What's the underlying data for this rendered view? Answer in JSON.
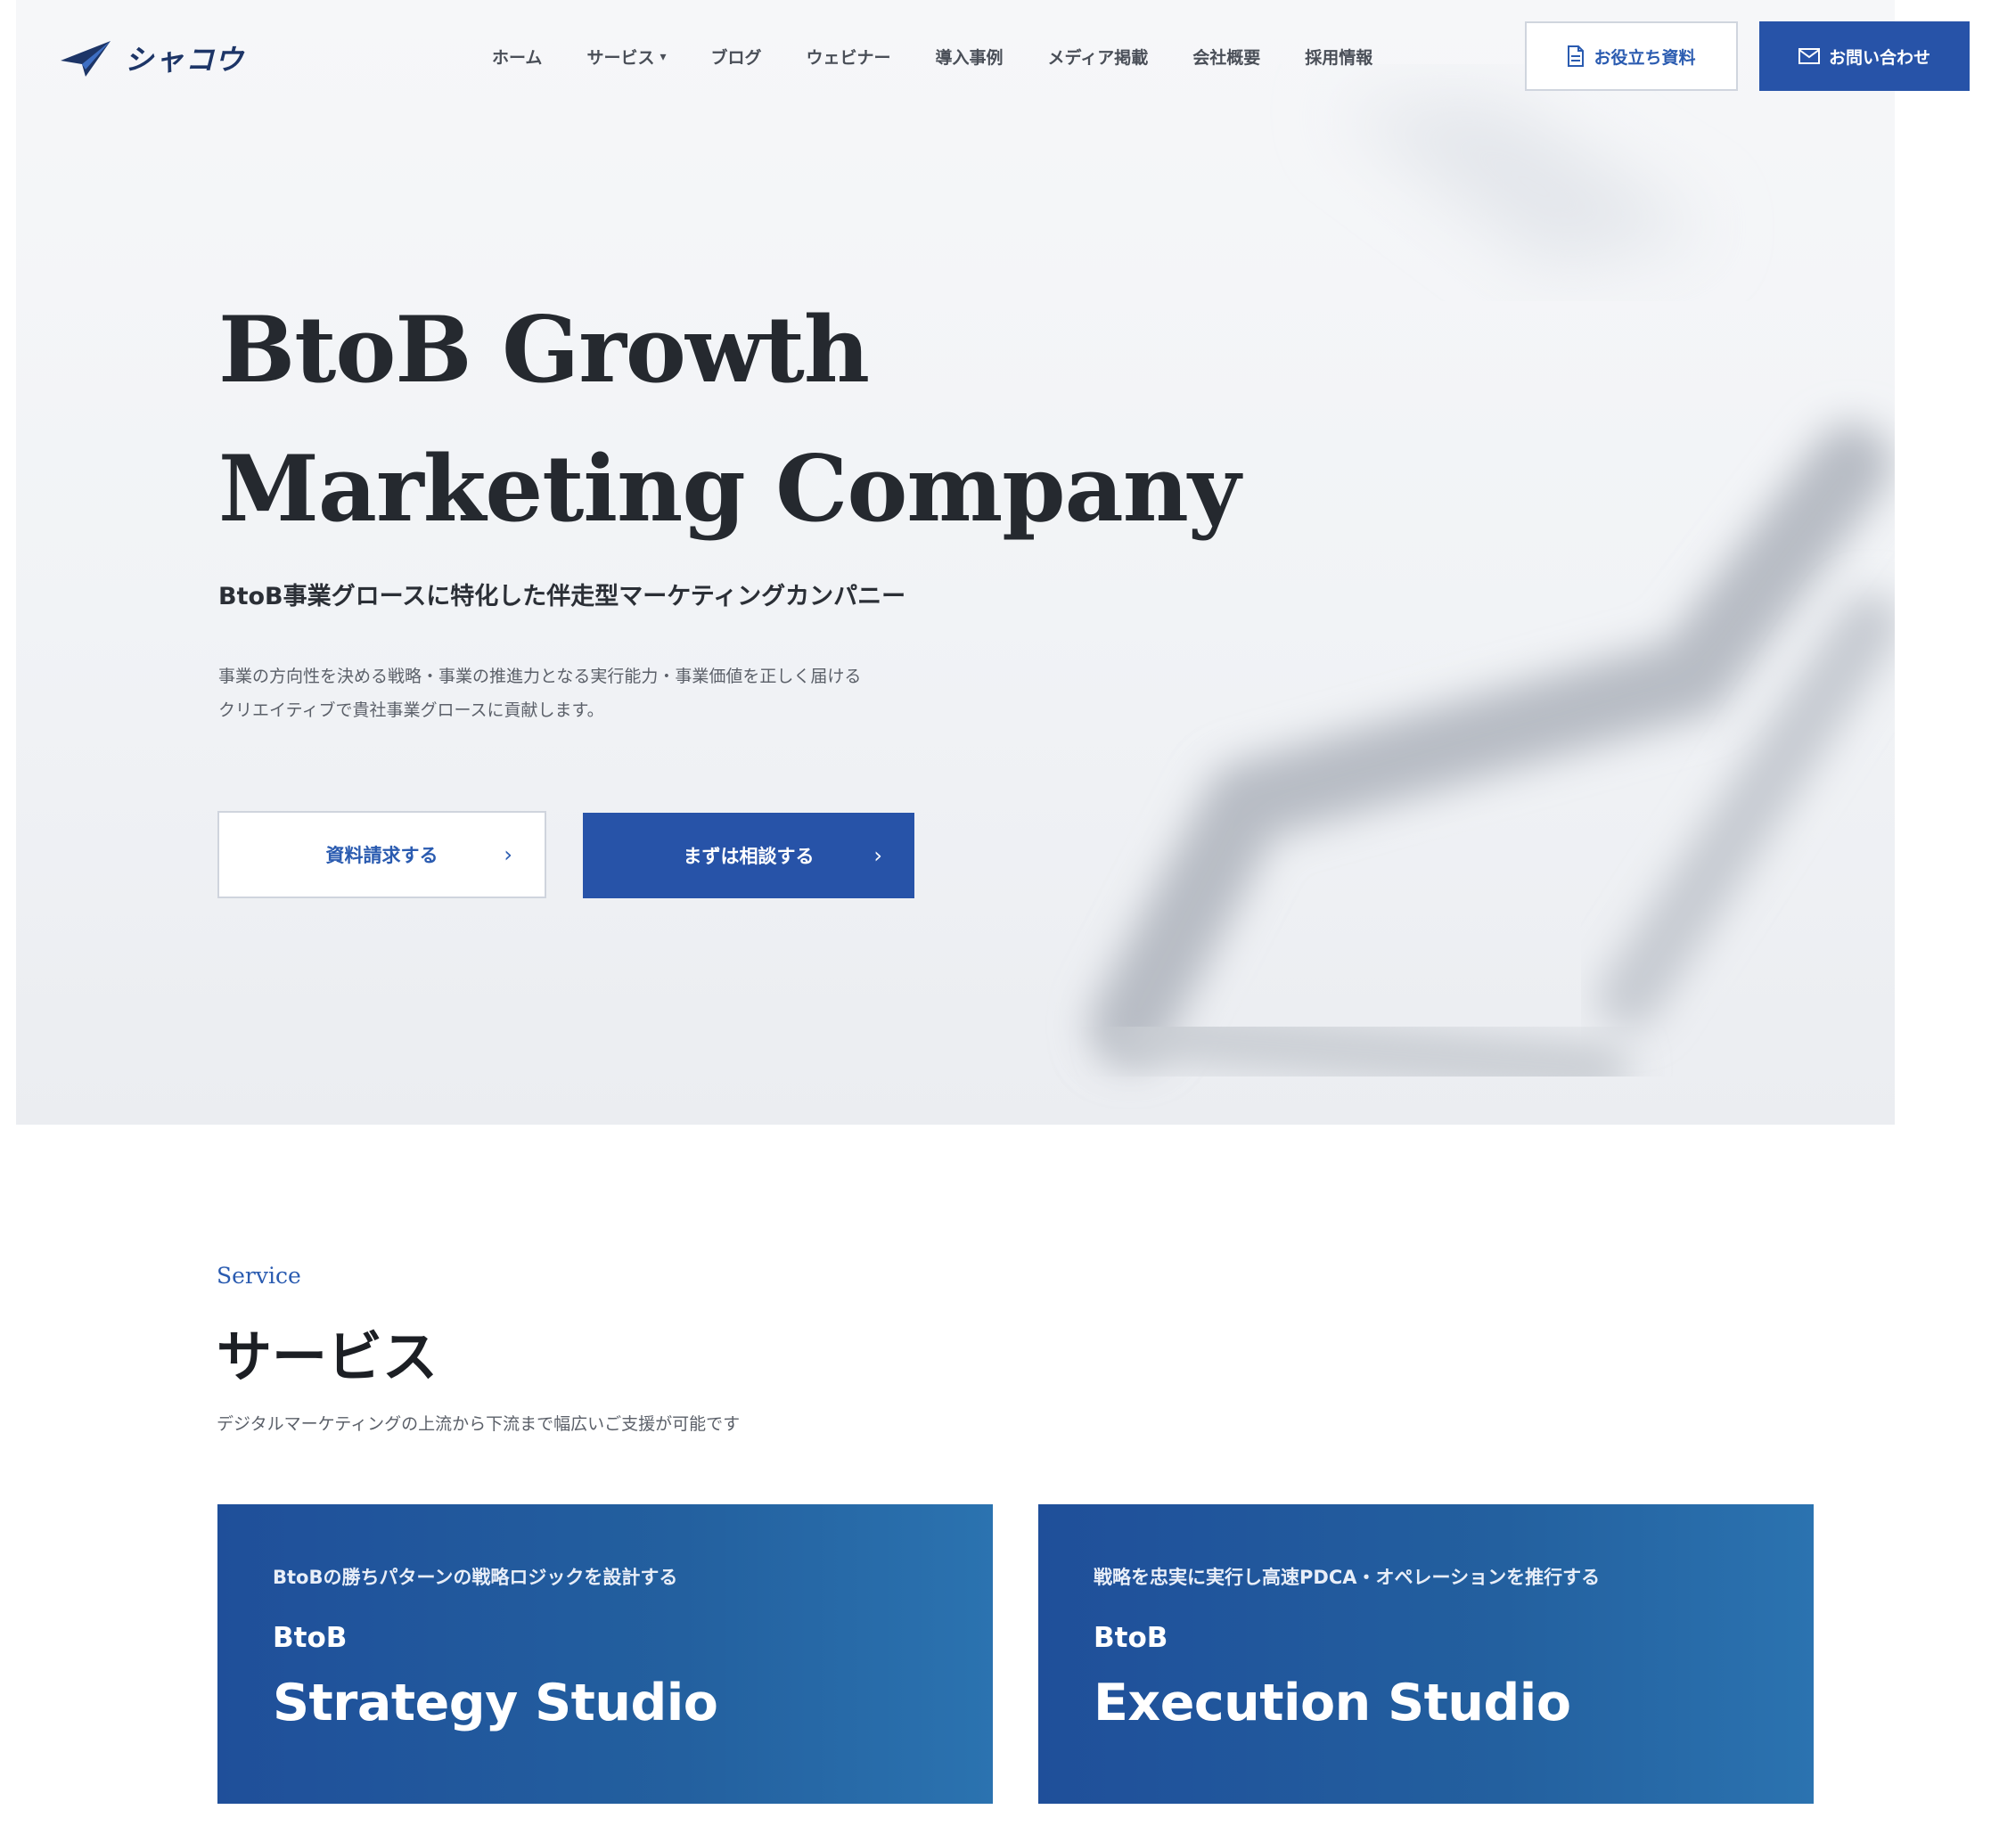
{
  "header": {
    "logo_text": "シャコウ",
    "nav": [
      {
        "label": "ホーム"
      },
      {
        "label": "サービス",
        "has_dropdown": true
      },
      {
        "label": "ブログ"
      },
      {
        "label": "ウェビナー"
      },
      {
        "label": "導入事例"
      },
      {
        "label": "メディア掲載"
      },
      {
        "label": "会社概要"
      },
      {
        "label": "採用情報"
      }
    ],
    "docs_button": "お役立ち資料",
    "contact_button": "お問い合わせ"
  },
  "hero": {
    "title_line1": "BtoB Growth",
    "title_line2": "Marketing Company",
    "subtitle": "BtoB事業グロースに特化した伴走型マーケティングカンパニー",
    "desc_line1": "事業の方向性を決める戦略・事業の推進力となる実行能力・事業価値を正しく届ける",
    "desc_line2": "クリエイティブで貴社事業グロースに貢献します。",
    "btn_request": "資料請求する",
    "btn_consult": "まずは相談する",
    "arrow": "›"
  },
  "services": {
    "label": "Service",
    "title": "サービス",
    "description": "デジタルマーケティングの上流から下流まで幅広いご支援が可能です",
    "cards": [
      {
        "tag": "BtoBの勝ちパターンの戦略ロジックを設計する",
        "kicker": "BtoB",
        "name": "Strategy Studio"
      },
      {
        "tag": "戦略を忠実に実行し高速PDCA・オペレーションを推行する",
        "kicker": "BtoB",
        "name": "Execution Studio"
      }
    ]
  },
  "colors": {
    "brand": "#2753a8",
    "card_blue": "#1f4f9a",
    "text_dark": "#25292f"
  },
  "icons": {
    "logo": "paper-plane-logo-icon",
    "docs": "document-icon",
    "contact": "mail-icon",
    "dropdown": "chevron-down-icon",
    "arrow": "chevron-right-icon"
  }
}
